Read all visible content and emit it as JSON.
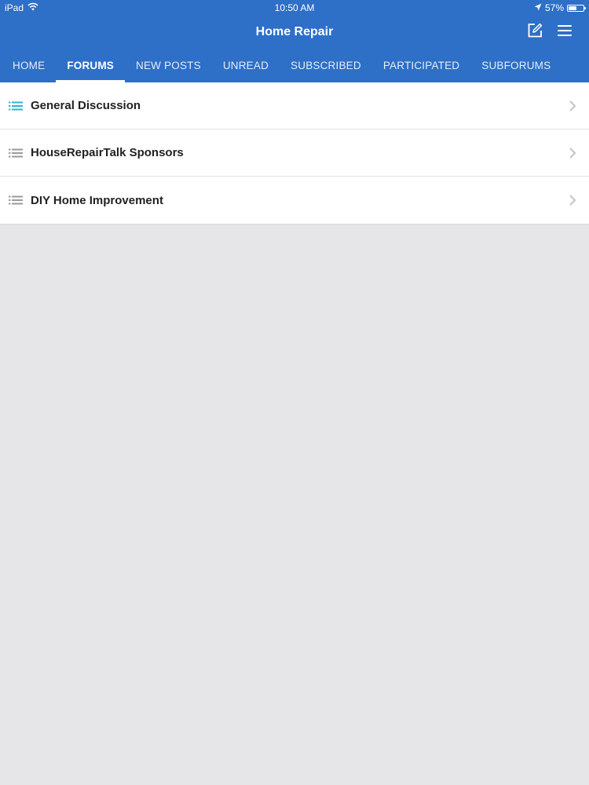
{
  "status": {
    "device": "iPad",
    "time": "10:50 AM",
    "battery": "57%",
    "battery_level": 0.57
  },
  "header": {
    "title": "Home Repair",
    "compose_icon": "compose-icon",
    "menu_icon": "hamburger-menu-icon"
  },
  "tabs": [
    {
      "label": "HOME",
      "active": false
    },
    {
      "label": "FORUMS",
      "active": true
    },
    {
      "label": "NEW POSTS",
      "active": false
    },
    {
      "label": "UNREAD",
      "active": false
    },
    {
      "label": "SUBSCRIBED",
      "active": false
    },
    {
      "label": "PARTICIPATED",
      "active": false
    },
    {
      "label": "SUBFORUMS",
      "active": false
    }
  ],
  "forums": [
    {
      "name": "General Discussion",
      "icon": "list-icon",
      "icon_color": "#2bb5d8"
    },
    {
      "name": "HouseRepairTalk Sponsors",
      "icon": "list-icon",
      "icon_color": "#9a9aa0"
    },
    {
      "name": "DIY Home Improvement",
      "icon": "list-icon",
      "icon_color": "#9a9aa0"
    }
  ],
  "colors": {
    "brand": "#2e6fc7",
    "background": "#e6e5e8",
    "text": "#222222"
  }
}
